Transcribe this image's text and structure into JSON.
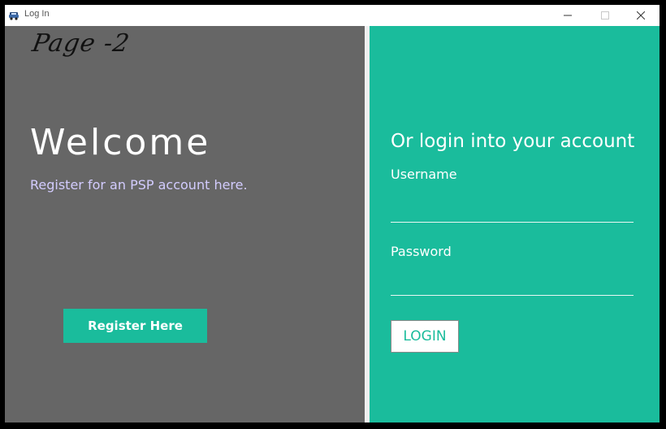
{
  "window": {
    "title": "Log In",
    "icon": "car-icon"
  },
  "left": {
    "annotation": "Page -2",
    "welcome": "Welcome",
    "subtitle": "Register for an PSP account here.",
    "register_button": "Register Here"
  },
  "right": {
    "heading": "Or login into your account",
    "username_label": "Username",
    "username_value": "",
    "password_label": "Password",
    "password_value": "",
    "login_button": "LOGIN"
  },
  "colors": {
    "left_panel": "#666666",
    "right_panel": "#1abc9c",
    "subtitle": "#d3ccff",
    "register_button": "#1abc9c"
  }
}
